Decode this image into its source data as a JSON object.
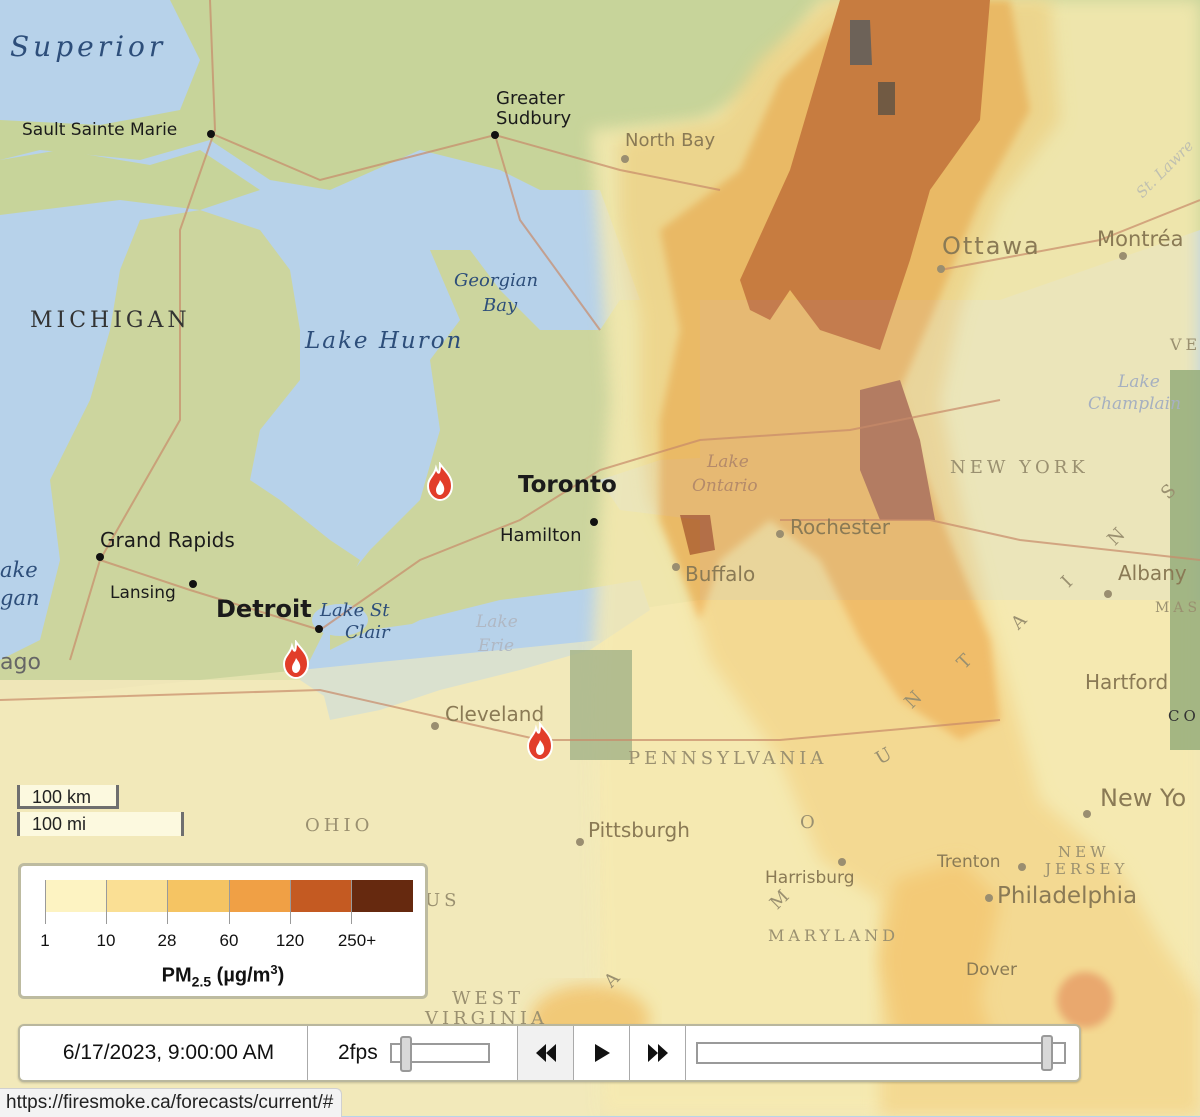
{
  "map": {
    "labels": {
      "water": {
        "superior": "Superior",
        "lake_huron": "Lake Huron",
        "georgian_bay_1": "Georgian",
        "georgian_bay_2": "Bay",
        "lake_michigan_1": "ake",
        "lake_michigan_2": "gan",
        "lake_st_clair_1": "Lake St",
        "lake_st_clair_2": "Clair",
        "lake_erie_1": "Lake",
        "lake_erie_2": "Erie",
        "lake_ontario_1": "Lake",
        "lake_ontario_2": "Ontario",
        "lake_champlain_1": "Lake",
        "lake_champlain_2": "Champlain",
        "st_lawrence": "St. Lawre"
      },
      "cities": {
        "sault_ste_marie": "Sault Sainte Marie",
        "greater_sudbury_1": "Greater",
        "greater_sudbury_2": "Sudbury",
        "north_bay": "North Bay",
        "ottawa": "Ottawa",
        "montreal": "Montréa",
        "toronto": "Toronto",
        "hamilton": "Hamilton",
        "grand_rapids": "Grand Rapids",
        "lansing": "Lansing",
        "detroit": "Detroit",
        "chicago": "ago",
        "cleveland": "Cleveland",
        "buffalo": "Buffalo",
        "rochester": "Rochester",
        "albany": "Albany",
        "hartford": "Hartford",
        "new_york": "New Yo",
        "pittsburgh": "Pittsburgh",
        "harrisburg": "Harrisburg",
        "trenton": "Trenton",
        "philadelphia": "Philadelphia",
        "dover": "Dover"
      },
      "regions": {
        "michigan": "MICHIGAN",
        "new_york": "NEW YORK",
        "pennsylvania": "PENNSYLVANIA",
        "ohio": "OHIO",
        "maryland": "MARYLAND",
        "new_jersey_1": "NEW",
        "new_jersey_2": "JERSEY",
        "west_virginia_1": "WEST",
        "west_virginia_2": "VIRGINIA",
        "vermont": "VE",
        "mass": "MASS",
        "conn": "CON",
        "us": "US",
        "appalachian": [
          "M",
          "O",
          "U",
          "N",
          "T",
          "A",
          "I",
          "N",
          "S"
        ],
        "appalachian_a": "A"
      }
    },
    "fire_markers": [
      "fire-lake-huron",
      "fire-detroit",
      "fire-ohio"
    ]
  },
  "scale": {
    "km_label": "100 km",
    "mi_label": "100 mi"
  },
  "legend": {
    "colors": [
      "#fdf3c2",
      "#fadf94",
      "#f5c463",
      "#f0a045",
      "#c45a22",
      "#66290f"
    ],
    "ticks": [
      "1",
      "10",
      "28",
      "60",
      "120",
      "250+"
    ],
    "title_main": "PM",
    "title_sub": "2.5",
    "title_unit_pre": " (µg/m",
    "title_unit_sup": "3",
    "title_unit_post": ")"
  },
  "controls": {
    "datetime": "6/17/2023, 9:00:00 AM",
    "fps_label": "2fps",
    "fps_slider_fraction": 0.1,
    "time_slider_fraction": 0.97,
    "rewind_icon": "rewind",
    "play_icon": "play",
    "forward_icon": "fast-forward"
  },
  "status_bar": {
    "url": "https://firesmoke.ca/forecasts/current/#"
  }
}
